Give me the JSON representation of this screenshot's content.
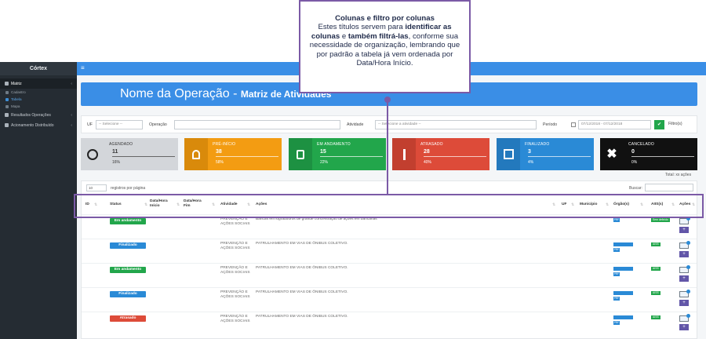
{
  "sidebar": {
    "brand": "Córtex",
    "items": [
      {
        "label": "Matriz",
        "icon": "grid-icon",
        "caret": "‹"
      },
      {
        "label": "Cadastro",
        "icon": "edit-icon"
      },
      {
        "label": "Tabela",
        "icon": "table-icon"
      },
      {
        "label": "Mapa",
        "icon": "map-icon"
      },
      {
        "label": "Resultados Operações",
        "icon": "chart-icon",
        "caret": "‹"
      },
      {
        "label": "Acionamento Distribuído",
        "icon": "car-icon",
        "caret": "‹"
      }
    ]
  },
  "topbar": {
    "menu_icon": "≡"
  },
  "banner": {
    "title": "Nome da Operação - ",
    "subtitle": "Matriz de Atividades"
  },
  "filters": {
    "uf_label": "UF",
    "uf_value": "-- Selecione --",
    "operacao_label": "Operação",
    "atividade_label": "Atividade",
    "atividade_placeholder": "-- Selecione a atividade --",
    "periodo_label": "Período",
    "periodo_value": "07/12/2018 - 07/12/2018",
    "apply_icon": "✔",
    "filtro_label": "Filtro(s)"
  },
  "cards": [
    {
      "title": "AGENDADO",
      "count": "11",
      "percent": "16%",
      "color": "#d3d6da",
      "icon": "clock-icon"
    },
    {
      "title": "PRÉ-INÍCIO",
      "count": "38",
      "percent": "58%",
      "color": "#f39c12",
      "icon": "bell-icon"
    },
    {
      "title": "EM ANDAMENTO",
      "count": "15",
      "percent": "22%",
      "color": "#22a64b",
      "icon": "thumbs-up-icon"
    },
    {
      "title": "ATRASADO",
      "count": "28",
      "percent": "40%",
      "color": "#dd4b39",
      "icon": "exclamation-icon"
    },
    {
      "title": "FINALIZADO",
      "count": "3",
      "percent": "4%",
      "color": "#2a8ad6",
      "icon": "check-square-icon"
    },
    {
      "title": "CANCELADO",
      "count": "0",
      "percent": "0%",
      "color": "#111111",
      "icon": "x-icon"
    }
  ],
  "total_text": "Total: xx ações",
  "table": {
    "page_size": "10",
    "page_size_label": "registros por página",
    "search_label": "Buscar:",
    "columns": [
      "ID",
      "Status",
      "Data/Hora Início",
      "Data/Hora Fim",
      "Atividade",
      "Ações",
      "UF",
      "Município",
      "Órgão(s)",
      "AIIS(s)",
      "Ações"
    ],
    "rows": [
      {
        "status": "Em andamento",
        "status_color": "#22a64b",
        "atividade": "PREVENÇÃO E AÇÕES SOCIAIS",
        "acao": "Bancas em logradouros de grande concentração de ações em bancárias",
        "orgao": "PRF",
        "aiss": "Sem definido"
      },
      {
        "status": "Finalizado",
        "status_color": "#2a8ad6",
        "atividade": "PREVENÇÃO E AÇÕES SOCIAIS",
        "acao": "PATRULHAMENTO EM VIAS DE ÔNIBUS COLETIVO.",
        "orgao": "PRF",
        "aiss": "AISS"
      },
      {
        "status": "Em andamento",
        "status_color": "#22a64b",
        "atividade": "PREVENÇÃO E AÇÕES SOCIAIS",
        "acao": "PATRULHAMENTO EM VIAS DE ÔNIBUS COLETIVO.",
        "orgao": "PRF",
        "aiss": "AISS"
      },
      {
        "status": "Finalizado",
        "status_color": "#2a8ad6",
        "atividade": "PREVENÇÃO E AÇÕES SOCIAIS",
        "acao": "PATRULHAMENTO EM VIAS DE ÔNIBUS COLETIVO.",
        "orgao": "PRF",
        "aiss": "AISS"
      },
      {
        "status": "Atrasado",
        "status_color": "#dd4b39",
        "atividade": "PREVENÇÃO E AÇÕES SOCIAIS",
        "acao": "PATRULHAMENTO EM VIAS DE ÔNIBUS COLETIVO.",
        "orgao": "PRF",
        "aiss": "AISS"
      }
    ]
  },
  "callout": {
    "title": "Colunas e filtro por colunas",
    "text_1": "Estes títulos servem para ",
    "bold_1": "identificar as colunas",
    "text_2": " e ",
    "bold_2": "também filtrá-las",
    "text_3": ", conforme sua necessidade de organização, lembrando que por padrão a tabela já vem ordenada por Data/Hora Início."
  },
  "accent_color": "#7b5aa6"
}
